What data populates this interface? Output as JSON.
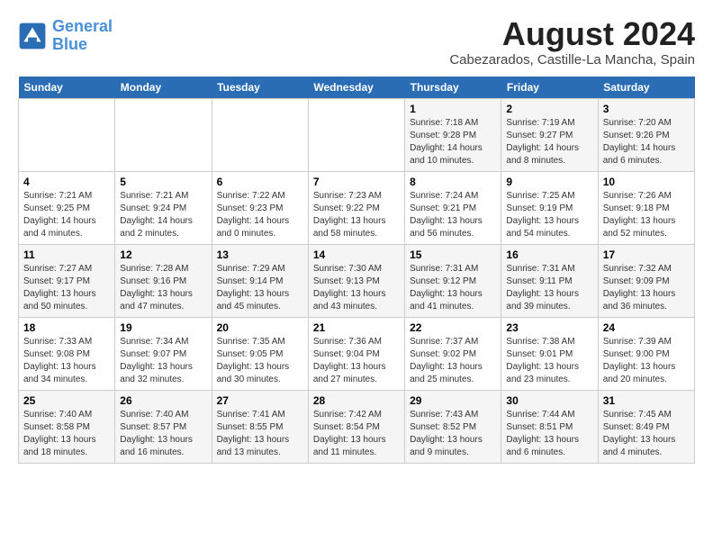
{
  "logo": {
    "line1": "General",
    "line2": "Blue"
  },
  "title": "August 2024",
  "location": "Cabezarados, Castille-La Mancha, Spain",
  "headers": [
    "Sunday",
    "Monday",
    "Tuesday",
    "Wednesday",
    "Thursday",
    "Friday",
    "Saturday"
  ],
  "weeks": [
    [
      {
        "day": "",
        "info": ""
      },
      {
        "day": "",
        "info": ""
      },
      {
        "day": "",
        "info": ""
      },
      {
        "day": "",
        "info": ""
      },
      {
        "day": "1",
        "info": "Sunrise: 7:18 AM\nSunset: 9:28 PM\nDaylight: 14 hours\nand 10 minutes."
      },
      {
        "day": "2",
        "info": "Sunrise: 7:19 AM\nSunset: 9:27 PM\nDaylight: 14 hours\nand 8 minutes."
      },
      {
        "day": "3",
        "info": "Sunrise: 7:20 AM\nSunset: 9:26 PM\nDaylight: 14 hours\nand 6 minutes."
      }
    ],
    [
      {
        "day": "4",
        "info": "Sunrise: 7:21 AM\nSunset: 9:25 PM\nDaylight: 14 hours\nand 4 minutes."
      },
      {
        "day": "5",
        "info": "Sunrise: 7:21 AM\nSunset: 9:24 PM\nDaylight: 14 hours\nand 2 minutes."
      },
      {
        "day": "6",
        "info": "Sunrise: 7:22 AM\nSunset: 9:23 PM\nDaylight: 14 hours\nand 0 minutes."
      },
      {
        "day": "7",
        "info": "Sunrise: 7:23 AM\nSunset: 9:22 PM\nDaylight: 13 hours\nand 58 minutes."
      },
      {
        "day": "8",
        "info": "Sunrise: 7:24 AM\nSunset: 9:21 PM\nDaylight: 13 hours\nand 56 minutes."
      },
      {
        "day": "9",
        "info": "Sunrise: 7:25 AM\nSunset: 9:19 PM\nDaylight: 13 hours\nand 54 minutes."
      },
      {
        "day": "10",
        "info": "Sunrise: 7:26 AM\nSunset: 9:18 PM\nDaylight: 13 hours\nand 52 minutes."
      }
    ],
    [
      {
        "day": "11",
        "info": "Sunrise: 7:27 AM\nSunset: 9:17 PM\nDaylight: 13 hours\nand 50 minutes."
      },
      {
        "day": "12",
        "info": "Sunrise: 7:28 AM\nSunset: 9:16 PM\nDaylight: 13 hours\nand 47 minutes."
      },
      {
        "day": "13",
        "info": "Sunrise: 7:29 AM\nSunset: 9:14 PM\nDaylight: 13 hours\nand 45 minutes."
      },
      {
        "day": "14",
        "info": "Sunrise: 7:30 AM\nSunset: 9:13 PM\nDaylight: 13 hours\nand 43 minutes."
      },
      {
        "day": "15",
        "info": "Sunrise: 7:31 AM\nSunset: 9:12 PM\nDaylight: 13 hours\nand 41 minutes."
      },
      {
        "day": "16",
        "info": "Sunrise: 7:31 AM\nSunset: 9:11 PM\nDaylight: 13 hours\nand 39 minutes."
      },
      {
        "day": "17",
        "info": "Sunrise: 7:32 AM\nSunset: 9:09 PM\nDaylight: 13 hours\nand 36 minutes."
      }
    ],
    [
      {
        "day": "18",
        "info": "Sunrise: 7:33 AM\nSunset: 9:08 PM\nDaylight: 13 hours\nand 34 minutes."
      },
      {
        "day": "19",
        "info": "Sunrise: 7:34 AM\nSunset: 9:07 PM\nDaylight: 13 hours\nand 32 minutes."
      },
      {
        "day": "20",
        "info": "Sunrise: 7:35 AM\nSunset: 9:05 PM\nDaylight: 13 hours\nand 30 minutes."
      },
      {
        "day": "21",
        "info": "Sunrise: 7:36 AM\nSunset: 9:04 PM\nDaylight: 13 hours\nand 27 minutes."
      },
      {
        "day": "22",
        "info": "Sunrise: 7:37 AM\nSunset: 9:02 PM\nDaylight: 13 hours\nand 25 minutes."
      },
      {
        "day": "23",
        "info": "Sunrise: 7:38 AM\nSunset: 9:01 PM\nDaylight: 13 hours\nand 23 minutes."
      },
      {
        "day": "24",
        "info": "Sunrise: 7:39 AM\nSunset: 9:00 PM\nDaylight: 13 hours\nand 20 minutes."
      }
    ],
    [
      {
        "day": "25",
        "info": "Sunrise: 7:40 AM\nSunset: 8:58 PM\nDaylight: 13 hours\nand 18 minutes."
      },
      {
        "day": "26",
        "info": "Sunrise: 7:40 AM\nSunset: 8:57 PM\nDaylight: 13 hours\nand 16 minutes."
      },
      {
        "day": "27",
        "info": "Sunrise: 7:41 AM\nSunset: 8:55 PM\nDaylight: 13 hours\nand 13 minutes."
      },
      {
        "day": "28",
        "info": "Sunrise: 7:42 AM\nSunset: 8:54 PM\nDaylight: 13 hours\nand 11 minutes."
      },
      {
        "day": "29",
        "info": "Sunrise: 7:43 AM\nSunset: 8:52 PM\nDaylight: 13 hours\nand 9 minutes."
      },
      {
        "day": "30",
        "info": "Sunrise: 7:44 AM\nSunset: 8:51 PM\nDaylight: 13 hours\nand 6 minutes."
      },
      {
        "day": "31",
        "info": "Sunrise: 7:45 AM\nSunset: 8:49 PM\nDaylight: 13 hours\nand 4 minutes."
      }
    ]
  ]
}
